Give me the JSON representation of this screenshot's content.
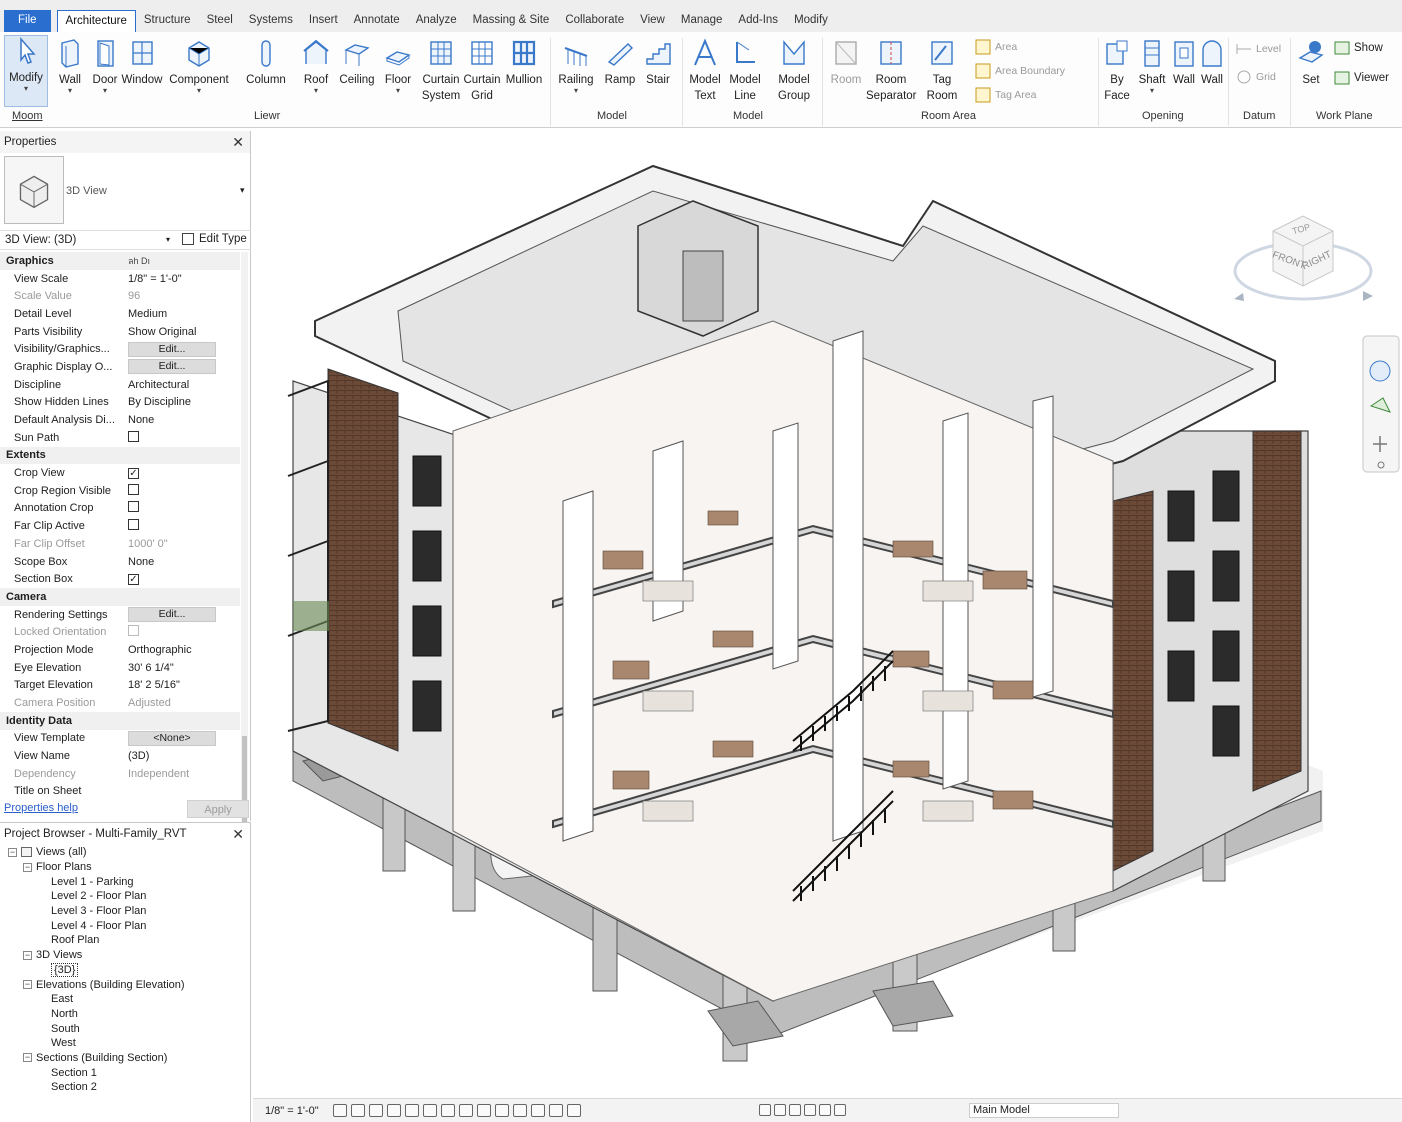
{
  "ribbon": {
    "tabs": [
      "File",
      "Architecture",
      "Structure",
      "Steel",
      "Systems",
      "Insert",
      "Annotate",
      "Analyze",
      "Massing & Site",
      "Collaborate",
      "View",
      "Manage",
      "Add-Ins",
      "Modify"
    ],
    "active_tab": "Architecture",
    "buttons": {
      "modify": "Modify",
      "wall": "Wall",
      "door": "Door",
      "window": "Window",
      "component": "Component",
      "column": "Column",
      "roof": "Roof",
      "ceiling": "Ceiling",
      "floor": "Floor",
      "curtain_system": "Curtain System",
      "curtain_grid": "Curtain Grid",
      "mullion": "Mullion",
      "railing": "Railing",
      "ramp": "Ramp",
      "stair": "Stair",
      "model_text": "Model Text",
      "model_line": "Model Line",
      "model_group": "Model Group",
      "room": "Room",
      "room_separator": "Room Separator",
      "tag_room": "Tag Room",
      "area": "Area",
      "area_boundary": "Area Boundary",
      "tag_area": "Tag Area",
      "by_face": "By Face",
      "shaft": "Shaft",
      "wall_opening": "Wall",
      "wall2": "Wall",
      "level": "Level",
      "grid": "Grid",
      "set": "Set",
      "show": "Show",
      "viewer": "Viewer"
    },
    "groups": {
      "select": "Moom",
      "build": "Liewr",
      "circulation": "Model",
      "model": "Model",
      "room_area": "Room Area",
      "opening": "Opening",
      "datum": "Datum",
      "work_plane": "Work Plane"
    }
  },
  "properties": {
    "title": "Properties",
    "type_name": "3D View",
    "view_selector": "3D View: (3D)",
    "edit_type": "Edit Type",
    "rows": [
      {
        "kind": "header",
        "key": "Graphics",
        "value": "ลh Dı"
      },
      {
        "key": "View Scale",
        "value": "1/8\" = 1'-0\""
      },
      {
        "key": "Scale Value",
        "value": "96",
        "muted": true
      },
      {
        "key": "Detail Level",
        "value": "Medium"
      },
      {
        "key": "Parts Visibility",
        "value": "Show Original"
      },
      {
        "key": "Visibility/Graphics...",
        "button": "Edit..."
      },
      {
        "key": "Graphic Display O...",
        "button": "Edit..."
      },
      {
        "key": "Discipline",
        "value": "Architectural"
      },
      {
        "key": "Show Hidden Lines",
        "value": "By Discipline"
      },
      {
        "key": "Default Analysis Di...",
        "value": "None"
      },
      {
        "key": "Sun Path",
        "check": false
      },
      {
        "kind": "header",
        "key": "Extents"
      },
      {
        "key": "Crop View",
        "check": true
      },
      {
        "key": "Crop Region Visible",
        "check": false
      },
      {
        "key": "Annotation Crop",
        "check": false
      },
      {
        "key": "Far Clip Active",
        "check": false
      },
      {
        "key": "Far Clip Offset",
        "value": "1000'  0\"",
        "muted": true
      },
      {
        "key": "Scope Box",
        "value": "None"
      },
      {
        "key": "Section Box",
        "check": true
      },
      {
        "kind": "header",
        "key": "Camera"
      },
      {
        "key": "Rendering Settings",
        "button": "Edit..."
      },
      {
        "key": "Locked Orientation",
        "check": false,
        "muted": true
      },
      {
        "key": "Projection Mode",
        "value": "Orthographic"
      },
      {
        "key": "Eye Elevation",
        "value": "30'  6 1/4\""
      },
      {
        "key": "Target Elevation",
        "value": "18'  2 5/16\""
      },
      {
        "key": "Camera Position",
        "value": "Adjusted",
        "muted": true
      },
      {
        "kind": "header",
        "key": "Identity Data"
      },
      {
        "key": "View Template",
        "button": "<None>"
      },
      {
        "key": "View Name",
        "value": "(3D)"
      },
      {
        "key": "Dependency",
        "value": "Independent",
        "muted": true
      },
      {
        "key": "Title on Sheet",
        "value": ""
      }
    ],
    "help_link": "Properties help",
    "apply": "Apply"
  },
  "browser": {
    "title": "Project Browser - Multi-Family_RVT",
    "nodes": [
      {
        "depth": 0,
        "label": "Views (all)",
        "toggle": "-"
      },
      {
        "depth": 1,
        "label": "Floor Plans",
        "toggle": "-"
      },
      {
        "depth": 2,
        "label": "Level 1 - Parking"
      },
      {
        "depth": 2,
        "label": "Level 2 - Floor Plan"
      },
      {
        "depth": 2,
        "label": "Level 3 - Floor Plan"
      },
      {
        "depth": 2,
        "label": "Level 4 - Floor Plan"
      },
      {
        "depth": 2,
        "label": "Roof Plan"
      },
      {
        "depth": 1,
        "label": "3D Views",
        "toggle": "-"
      },
      {
        "depth": 2,
        "label": "{3D}",
        "selected": true
      },
      {
        "depth": 1,
        "label": "Elevations (Building Elevation)",
        "toggle": "-"
      },
      {
        "depth": 2,
        "label": "East"
      },
      {
        "depth": 2,
        "label": "North"
      },
      {
        "depth": 2,
        "label": "South"
      },
      {
        "depth": 2,
        "label": "West"
      },
      {
        "depth": 1,
        "label": "Sections (Building Section)",
        "toggle": "-"
      },
      {
        "depth": 2,
        "label": "Section 1"
      },
      {
        "depth": 2,
        "label": "Section 2"
      }
    ]
  },
  "viewcube": {
    "top": "TOP",
    "front": "FRONT",
    "right": "RIGHT"
  },
  "status": {
    "scale": "1/8\" = 1'-0\"",
    "model": "Main Model"
  },
  "colors": {
    "accent": "#2a6ed0",
    "ribbon_icon": "#3a78c9",
    "canvas": "#ffffff"
  }
}
